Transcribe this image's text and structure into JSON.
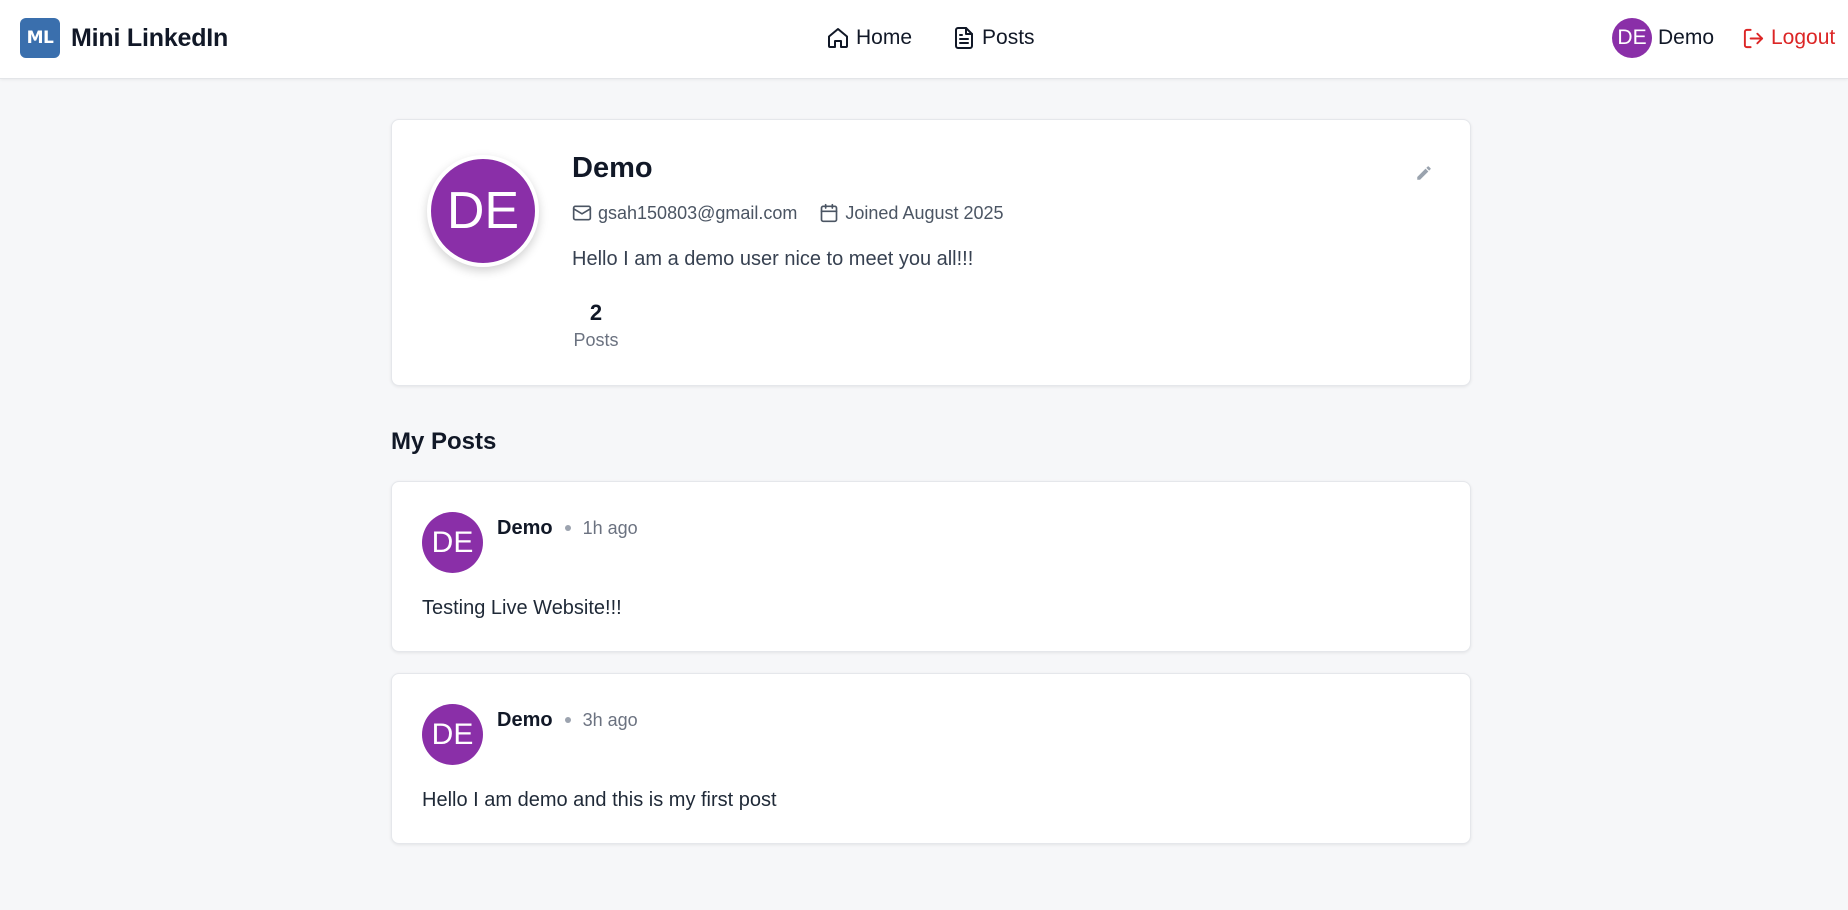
{
  "nav": {
    "brand_logo": "ML",
    "brand_name": "Mini LinkedIn",
    "links": [
      {
        "label": "Home",
        "icon": "home-icon"
      },
      {
        "label": "Posts",
        "icon": "document-icon"
      }
    ],
    "user_initials": "DE",
    "user_name": "Demo",
    "logout_label": "Logout",
    "logout_icon": "logout-icon"
  },
  "profile": {
    "initials": "DE",
    "name": "Demo",
    "email": "gsah150803@gmail.com",
    "joined": "Joined August 2025",
    "bio": "Hello I am a demo user nice to meet you all!!!",
    "posts_count": "2",
    "posts_label": "Posts",
    "edit_icon": "pencil-icon"
  },
  "posts_section": {
    "title": "My Posts",
    "items": [
      {
        "initials": "DE",
        "author": "Demo",
        "time": "1h ago",
        "content": "Testing Live Website!!!"
      },
      {
        "initials": "DE",
        "author": "Demo",
        "time": "3h ago",
        "content": "Hello I am demo and this is my first post"
      }
    ]
  },
  "colors": {
    "avatar": "#8a2fa8",
    "brand": "#3a6fad",
    "logout": "#dc2626",
    "background": "#f6f7f9"
  }
}
